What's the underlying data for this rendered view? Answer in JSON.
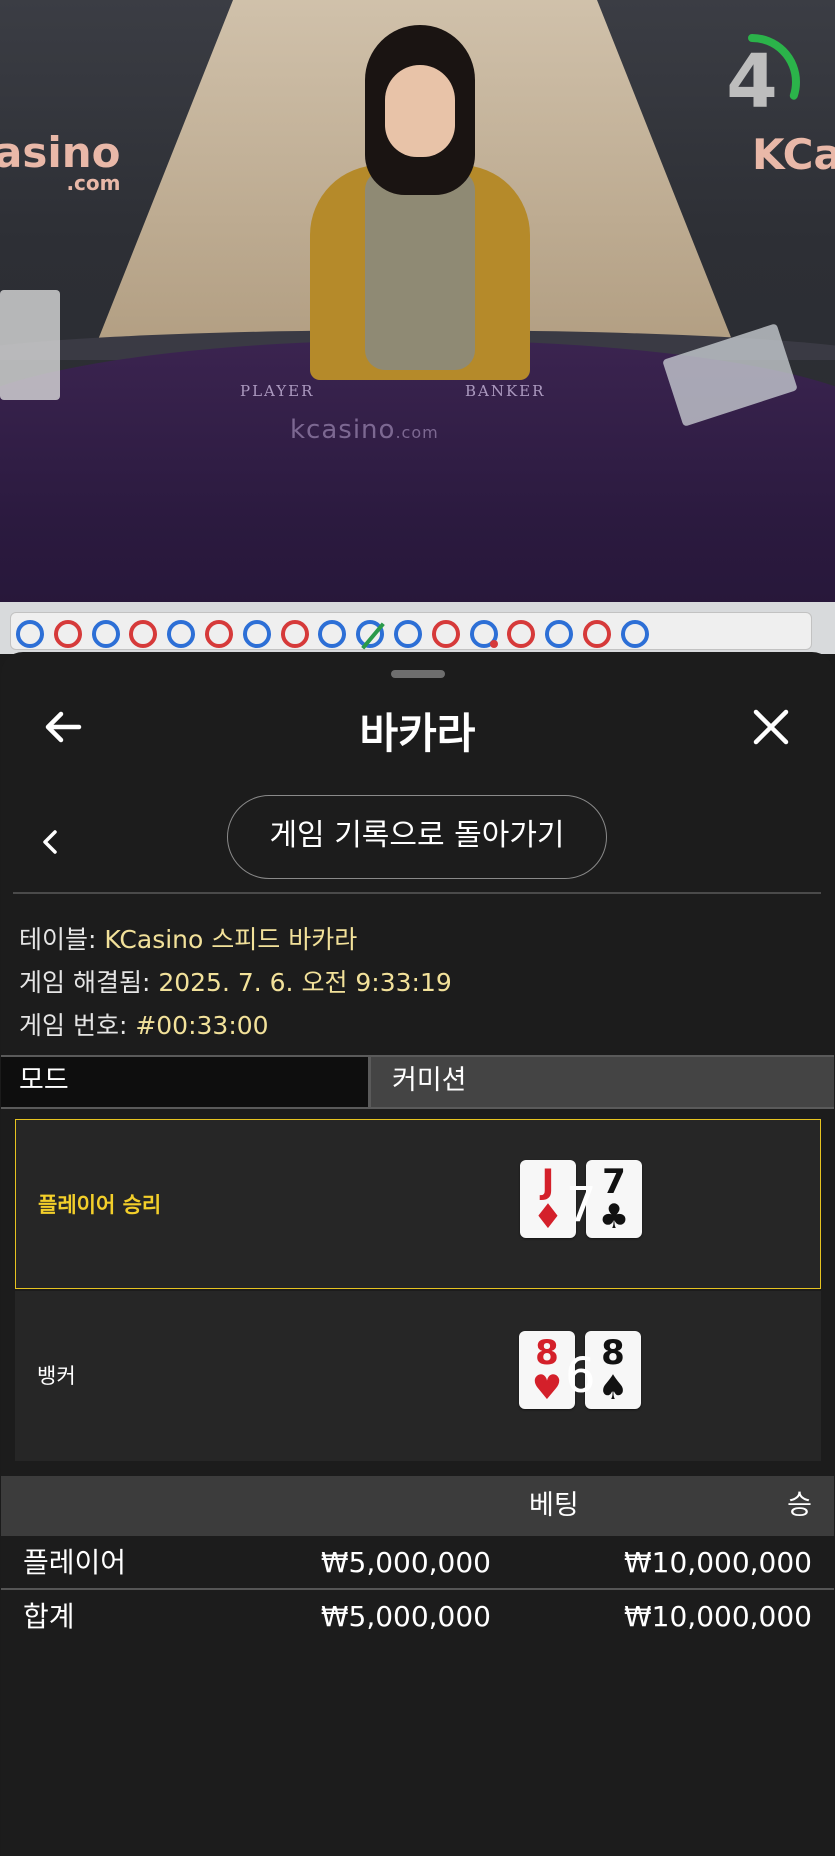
{
  "video": {
    "wall_logo_left": "asino",
    "wall_logo_left_sub": ".com",
    "wall_logo_right": "KCa",
    "table_player": "PLAYER",
    "table_banker": "BANKER",
    "table_logo": "kcasino",
    "table_logo_sub": ".com",
    "timer_value": "4",
    "timer_fraction": 0.3
  },
  "roadmap": {
    "beads": [
      "P",
      "B",
      "P",
      "B",
      "P",
      "B",
      "P",
      "B",
      "P",
      "P",
      "P",
      "B",
      "P",
      "B",
      "P",
      "B",
      "P"
    ],
    "tie_index": 9,
    "banker_pair_index": 12,
    "colors": {
      "player": "#2d6fd6",
      "banker": "#d63a3a",
      "tie": "#2a9a4a"
    }
  },
  "header": {
    "title": "바카라",
    "back_icon": "arrow-left-icon",
    "close_icon": "close-icon"
  },
  "history_button": {
    "label": "게임 기록으로 돌아가기",
    "back_icon": "chevron-left-icon"
  },
  "info": {
    "table_label": "테이블:",
    "table_value": "KCasino 스피드 바카라",
    "resolved_label": "게임 해결됨:",
    "resolved_value": "2025. 7. 6. 오전 9:33:19",
    "number_label": "게임 번호:",
    "number_value": "#00:33:00"
  },
  "tabs": {
    "mode": "모드",
    "commission": "커미션"
  },
  "hands": {
    "player": {
      "label": "플레이어 승리",
      "cards": [
        {
          "rank": "J",
          "suit": "♦",
          "color": "red"
        },
        {
          "rank": "7",
          "suit": "♣",
          "color": "black"
        }
      ],
      "score": "7"
    },
    "banker": {
      "label": "뱅커",
      "cards": [
        {
          "rank": "8",
          "suit": "♥",
          "color": "red"
        },
        {
          "rank": "8",
          "suit": "♠",
          "color": "black"
        }
      ],
      "score": "6"
    }
  },
  "bets": {
    "col_bet": "베팅",
    "col_win": "승",
    "rows": [
      {
        "name": "플레이어",
        "bet": "₩5,000,000",
        "win": "₩10,000,000"
      }
    ],
    "total": {
      "name": "합계",
      "bet": "₩5,000,000",
      "win": "₩10,000,000"
    }
  },
  "accent_color": "#e6c320"
}
